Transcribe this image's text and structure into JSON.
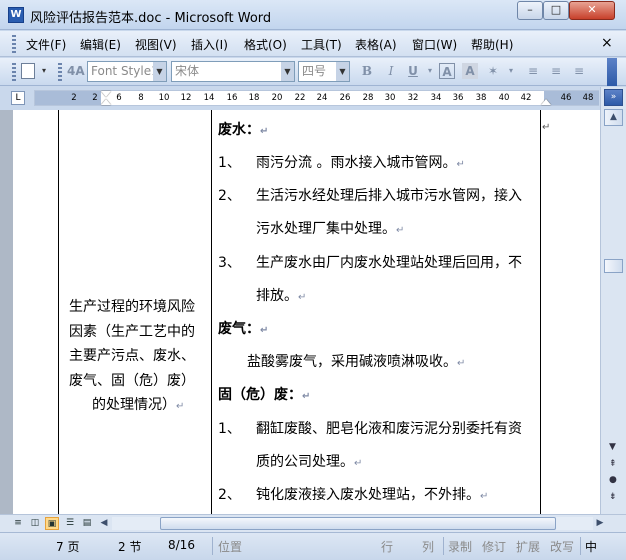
{
  "window": {
    "title": "风险评估报告范本.doc - Microsoft Word",
    "icon_label": "W",
    "min_glyph": "–",
    "max_glyph": "□",
    "close_glyph": "✕"
  },
  "menu": {
    "items": [
      "文件(F)",
      "编辑(E)",
      "视图(V)",
      "插入(I)",
      "格式(O)",
      "工具(T)",
      "表格(A)",
      "窗口(W)",
      "帮助(H)"
    ],
    "close_glyph": "×"
  },
  "toolbar": {
    "style_value": "Font Style1",
    "font_value": "宋体",
    "size_value": "四号",
    "bold_label": "B",
    "italic_label": "I",
    "underline_label": "U",
    "char_border_label": "A",
    "char_shading_label": "A",
    "highlight_label": "A"
  },
  "ruler": {
    "corner_glyph": "L",
    "ticks": [
      "2",
      "2",
      "6",
      "8",
      "10",
      "12",
      "14",
      "16",
      "18",
      "20",
      "22",
      "24",
      "26",
      "28",
      "30",
      "32",
      "34",
      "36",
      "38",
      "40",
      "42",
      "46",
      "48"
    ]
  },
  "document": {
    "left_cell_lines": [
      "生产过程的环境风险",
      "因素（生产工艺中的",
      "主要产污点、废水、",
      "废气、固（危）废）",
      "的处理情况）"
    ],
    "heading_wastewater": "废水：",
    "item1_num": "1、",
    "item1_text": "雨污分流 。雨水接入城市管网。",
    "item2_num": "2、",
    "item2_text_a": "生活污水经处理后排入城市污水管网，接入",
    "item2_text_b": "污水处理厂集中处理。",
    "item3_num": "3、",
    "item3_text_a": "生产废水由厂内废水处理站处理后回用，不",
    "item3_text_b": "排放。",
    "heading_gas": "废气：",
    "gas_text": "盐酸雾废气，采用碱液喷淋吸收。",
    "heading_solid": "固（危）废：",
    "solid1_num": "1、",
    "solid1_text_a": "翻缸废酸、肥皂化液和废污泥分别委托有资",
    "solid1_text_b": "质的公司处理。",
    "solid2_num": "2、",
    "solid2_text": "钝化废液接入废水处理站，不外排。",
    "para_mark": "↵"
  },
  "statusbar": {
    "page": "7 页",
    "section": "2 节",
    "page_of": "8/16",
    "position": "位置",
    "line": "行",
    "column": "列",
    "rec": "录制",
    "trk": "修订",
    "ext": "扩展",
    "ovr": "改写",
    "lang": "中"
  }
}
